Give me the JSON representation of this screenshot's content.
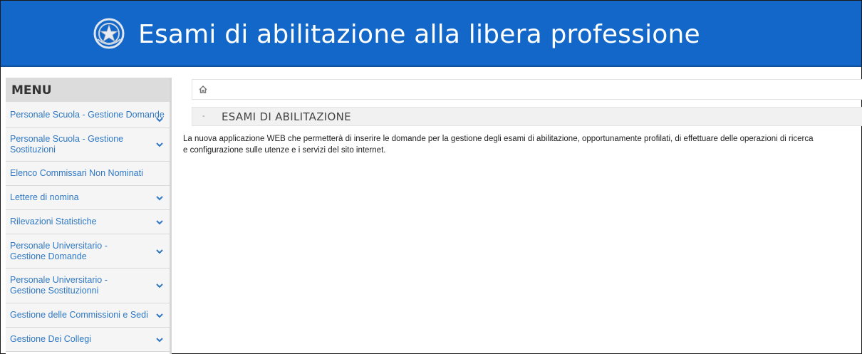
{
  "header": {
    "title": "Esami di abilitazione alla libera professione",
    "emblem_icon": "italian-republic-emblem-icon",
    "background_color": "#1267c9"
  },
  "sidebar": {
    "title": "MENU",
    "items": [
      {
        "label": "Personale Scuola - Gestione Domande",
        "has_chevron": true
      },
      {
        "label": "Personale Scuola - Gestione Sostituzioni",
        "has_chevron": true
      },
      {
        "label": "Elenco Commissari Non Nominati",
        "has_chevron": false
      },
      {
        "label": "Lettere di nomina",
        "has_chevron": true
      },
      {
        "label": "Rilevazioni Statistiche",
        "has_chevron": true
      },
      {
        "label": "Personale Universitario - Gestione Domande",
        "has_chevron": true
      },
      {
        "label": "Personale Universitario - Gestione Sostituzionni",
        "has_chevron": true
      },
      {
        "label": "Gestione delle Commissioni e Sedi",
        "has_chevron": true
      },
      {
        "label": "Gestione Dei Collegi",
        "has_chevron": true
      }
    ],
    "link_color": "#2f78c4"
  },
  "breadcrumb": {
    "icon": "home-icon"
  },
  "section": {
    "toggle": "-",
    "title": "ESAMI DI ABILITAZIONE"
  },
  "description": {
    "line1": "La nuova applicazione WEB che permetterà di inserire le domande per la gestione degli esami di abilitazione, opportunamente profilati, di effettuare delle operazioni di ricerca",
    "line2": "e configurazione sulle utenze e i servizi del sito internet."
  }
}
